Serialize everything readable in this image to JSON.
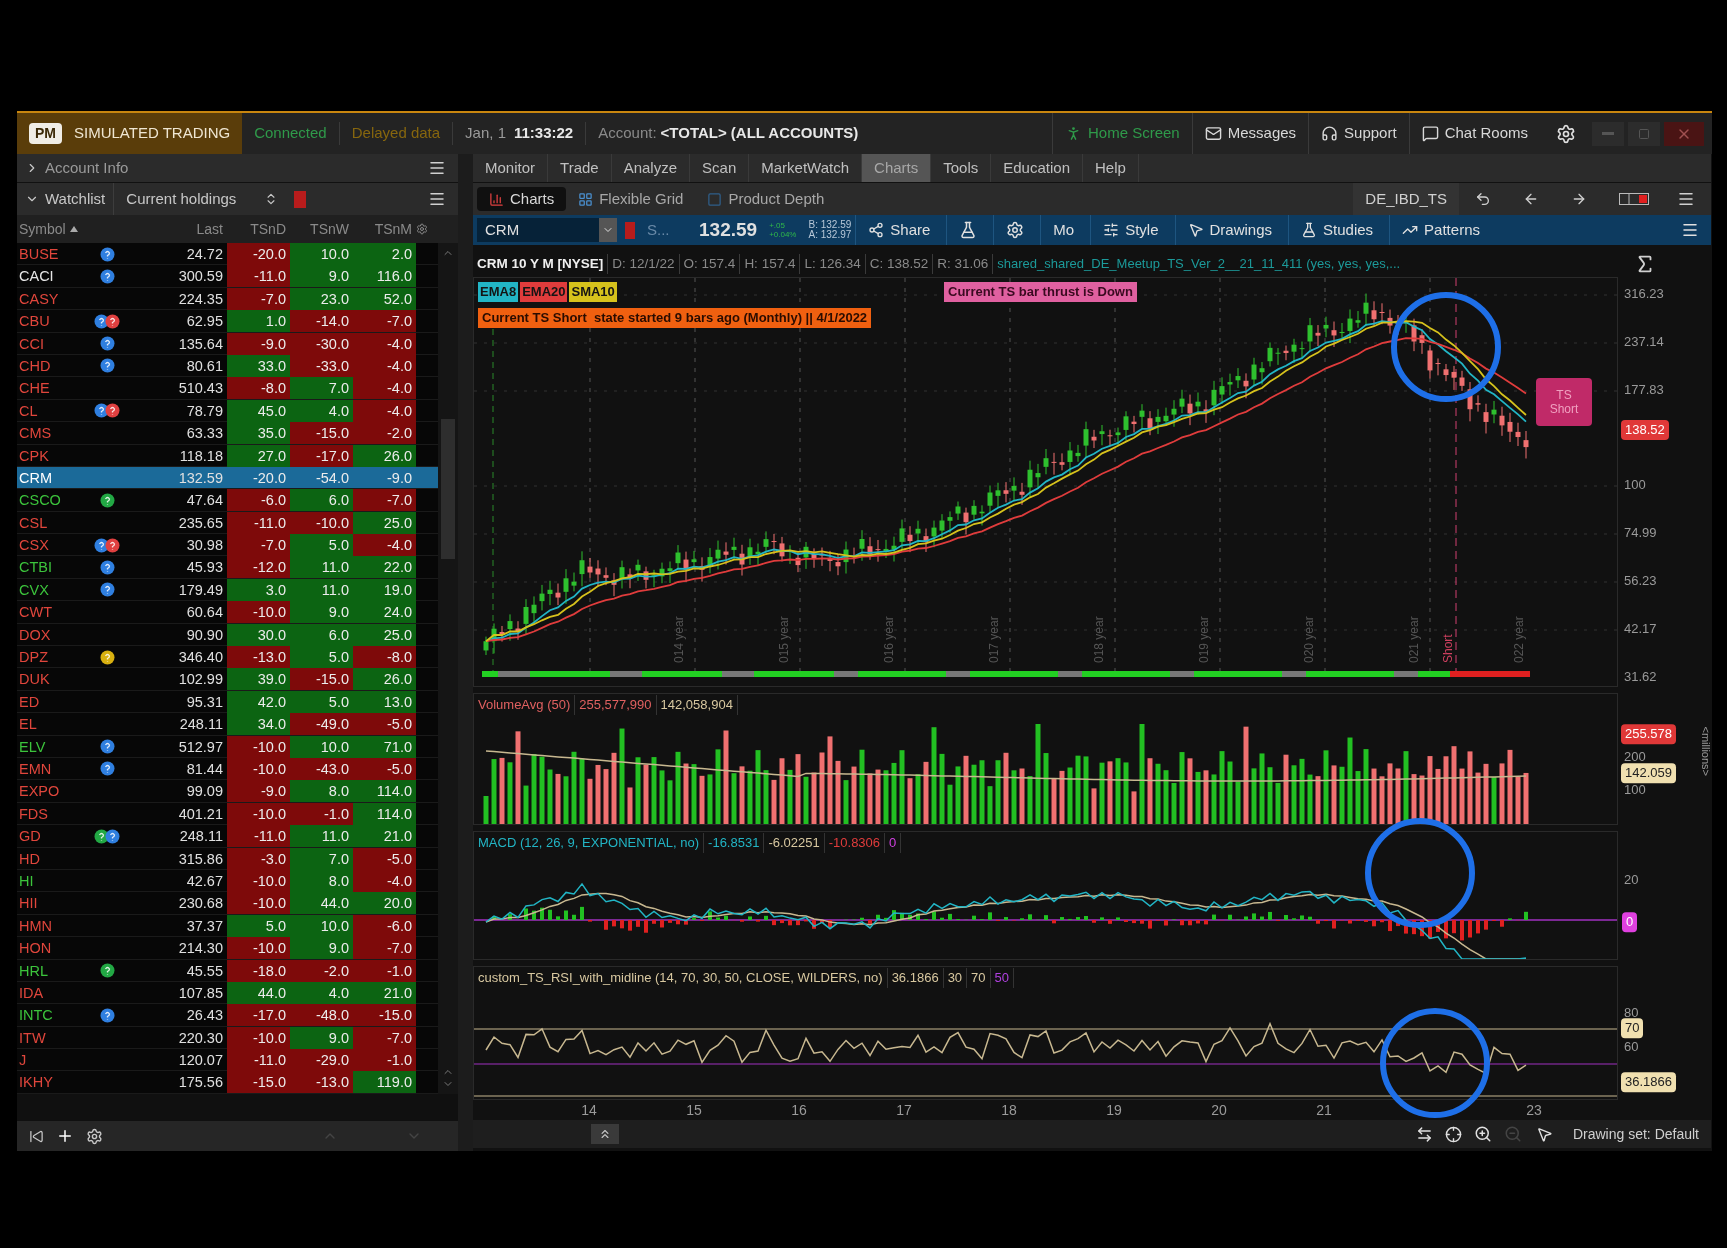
{
  "title_bar": {
    "badge": "PM",
    "mode": "SIMULATED TRADING",
    "connection": "Connected",
    "data_status": "Delayed data",
    "date": "Jan, 1",
    "time": "11:33:22",
    "account_label": "Account:",
    "account": "<TOTAL> (ALL ACCOUNTS)",
    "links": [
      {
        "kind": "home",
        "label": "Home Screen"
      },
      {
        "kind": "mail",
        "label": "Messages"
      },
      {
        "kind": "support",
        "label": "Support"
      },
      {
        "kind": "chat",
        "label": "Chat Rooms"
      }
    ]
  },
  "account_info": {
    "label": "Account Info",
    "expanded": false
  },
  "watchlist": {
    "label": "Watchlist",
    "expanded": true,
    "list": "Current holdings",
    "columns": [
      "Symbol",
      "Last",
      "TSnD",
      "TSnW",
      "TSnM"
    ],
    "rows": [
      {
        "symbol": "BUSE",
        "color": "#e0463c",
        "badges": [
          {
            "kind": "info"
          }
        ],
        "last": "24.72",
        "values": [
          "-20.0",
          "10.0",
          "2.0"
        ],
        "up": [
          false,
          true,
          true
        ],
        "selected": false
      },
      {
        "symbol": "CACI",
        "color": "#e6e6e6",
        "badges": [
          {
            "kind": "info"
          }
        ],
        "last": "300.59",
        "values": [
          "-11.0",
          "9.0",
          "116.0"
        ],
        "up": [
          false,
          true,
          true
        ],
        "selected": false
      },
      {
        "symbol": "CASY",
        "color": "#e0463c",
        "last": "224.35",
        "values": [
          "-7.0",
          "23.0",
          "52.0"
        ],
        "up": [
          false,
          true,
          true
        ],
        "selected": false
      },
      {
        "symbol": "CBU",
        "color": "#e0463c",
        "badges": [
          {
            "kind": "info"
          },
          {
            "kind": "alert"
          }
        ],
        "last": "62.95",
        "values": [
          "1.0",
          "-14.0",
          "-7.0"
        ],
        "up": [
          true,
          false,
          false
        ],
        "selected": false
      },
      {
        "symbol": "CCI",
        "color": "#e0463c",
        "badges": [
          {
            "kind": "info"
          }
        ],
        "last": "135.64",
        "values": [
          "-9.0",
          "-30.0",
          "-4.0"
        ],
        "up": [
          false,
          false,
          false
        ],
        "selected": false
      },
      {
        "symbol": "CHD",
        "color": "#e0463c",
        "badges": [
          {
            "kind": "info"
          }
        ],
        "last": "80.61",
        "values": [
          "33.0",
          "-33.0",
          "-4.0"
        ],
        "up": [
          true,
          false,
          false
        ],
        "selected": false
      },
      {
        "symbol": "CHE",
        "color": "#e0463c",
        "last": "510.43",
        "values": [
          "-8.0",
          "7.0",
          "-4.0"
        ],
        "up": [
          false,
          true,
          false
        ],
        "selected": false
      },
      {
        "symbol": "CL",
        "color": "#e0463c",
        "badges": [
          {
            "kind": "info"
          },
          {
            "kind": "alert"
          }
        ],
        "last": "78.79",
        "values": [
          "45.0",
          "4.0",
          "-4.0"
        ],
        "up": [
          true,
          true,
          false
        ],
        "selected": false
      },
      {
        "symbol": "CMS",
        "color": "#e0463c",
        "last": "63.33",
        "values": [
          "35.0",
          "-15.0",
          "-2.0"
        ],
        "up": [
          true,
          false,
          false
        ],
        "selected": false
      },
      {
        "symbol": "CPK",
        "color": "#e0463c",
        "last": "118.18",
        "values": [
          "27.0",
          "-17.0",
          "26.0"
        ],
        "up": [
          true,
          false,
          true
        ],
        "selected": false
      },
      {
        "symbol": "CRM",
        "last": "132.59",
        "values": [
          "-20.0",
          "-54.0",
          "-9.0"
        ],
        "selected": true
      },
      {
        "symbol": "CSCO",
        "color": "#3cc43c",
        "badges": [
          {
            "kind": "event"
          }
        ],
        "last": "47.64",
        "values": [
          "-6.0",
          "6.0",
          "-7.0"
        ],
        "up": [
          false,
          true,
          false
        ],
        "selected": false
      },
      {
        "symbol": "CSL",
        "color": "#e0463c",
        "last": "235.65",
        "values": [
          "-11.0",
          "-10.0",
          "25.0"
        ],
        "up": [
          false,
          false,
          true
        ],
        "selected": false
      },
      {
        "symbol": "CSX",
        "color": "#e0463c",
        "badges": [
          {
            "kind": "info"
          },
          {
            "kind": "alert"
          }
        ],
        "last": "30.98",
        "values": [
          "-7.0",
          "5.0",
          "-4.0"
        ],
        "up": [
          false,
          true,
          false
        ],
        "selected": false
      },
      {
        "symbol": "CTBI",
        "color": "#3cc43c",
        "badges": [
          {
            "kind": "info"
          }
        ],
        "last": "45.93",
        "values": [
          "-12.0",
          "11.0",
          "22.0"
        ],
        "up": [
          false,
          true,
          true
        ],
        "selected": false
      },
      {
        "symbol": "CVX",
        "color": "#3cc43c",
        "badges": [
          {
            "kind": "info"
          }
        ],
        "last": "179.49",
        "values": [
          "3.0",
          "11.0",
          "19.0"
        ],
        "up": [
          true,
          true,
          true
        ],
        "selected": false
      },
      {
        "symbol": "CWT",
        "color": "#e0463c",
        "last": "60.64",
        "values": [
          "-10.0",
          "9.0",
          "24.0"
        ],
        "up": [
          false,
          true,
          true
        ],
        "selected": false
      },
      {
        "symbol": "DOX",
        "color": "#e0463c",
        "last": "90.90",
        "values": [
          "30.0",
          "6.0",
          "25.0"
        ],
        "up": [
          true,
          true,
          true
        ],
        "selected": false
      },
      {
        "symbol": "DPZ",
        "color": "#e0463c",
        "badges": [
          {
            "kind": "dividend"
          }
        ],
        "last": "346.40",
        "values": [
          "-13.0",
          "5.0",
          "-8.0"
        ],
        "up": [
          false,
          true,
          false
        ],
        "selected": false
      },
      {
        "symbol": "DUK",
        "color": "#e0463c",
        "last": "102.99",
        "values": [
          "39.0",
          "-15.0",
          "26.0"
        ],
        "up": [
          true,
          false,
          true
        ],
        "selected": false
      },
      {
        "symbol": "ED",
        "color": "#e0463c",
        "last": "95.31",
        "values": [
          "42.0",
          "5.0",
          "13.0"
        ],
        "up": [
          true,
          true,
          true
        ],
        "selected": false
      },
      {
        "symbol": "EL",
        "color": "#e0463c",
        "last": "248.11",
        "values": [
          "34.0",
          "-49.0",
          "-5.0"
        ],
        "up": [
          true,
          false,
          false
        ],
        "selected": false
      },
      {
        "symbol": "ELV",
        "color": "#3cc43c",
        "badges": [
          {
            "kind": "info"
          }
        ],
        "last": "512.97",
        "values": [
          "-10.0",
          "10.0",
          "71.0"
        ],
        "up": [
          false,
          true,
          true
        ],
        "selected": false
      },
      {
        "symbol": "EMN",
        "color": "#e0463c",
        "badges": [
          {
            "kind": "info"
          }
        ],
        "last": "81.44",
        "values": [
          "-10.0",
          "-43.0",
          "-5.0"
        ],
        "up": [
          false,
          false,
          false
        ],
        "selected": false
      },
      {
        "symbol": "EXPO",
        "color": "#e0463c",
        "last": "99.09",
        "values": [
          "-9.0",
          "8.0",
          "114.0"
        ],
        "up": [
          false,
          true,
          true
        ],
        "selected": false
      },
      {
        "symbol": "FDS",
        "color": "#e0463c",
        "last": "401.21",
        "values": [
          "-10.0",
          "-1.0",
          "114.0"
        ],
        "up": [
          false,
          false,
          true
        ],
        "selected": false
      },
      {
        "symbol": "GD",
        "color": "#e0463c",
        "badges": [
          {
            "kind": "event"
          },
          {
            "kind": "info"
          }
        ],
        "last": "248.11",
        "values": [
          "-11.0",
          "11.0",
          "21.0"
        ],
        "up": [
          false,
          true,
          true
        ],
        "selected": false
      },
      {
        "symbol": "HD",
        "color": "#e0463c",
        "last": "315.86",
        "values": [
          "-3.0",
          "7.0",
          "-5.0"
        ],
        "up": [
          false,
          true,
          false
        ],
        "selected": false
      },
      {
        "symbol": "HI",
        "color": "#3cc43c",
        "last": "42.67",
        "values": [
          "-10.0",
          "8.0",
          "-4.0"
        ],
        "up": [
          false,
          true,
          false
        ],
        "selected": false
      },
      {
        "symbol": "HII",
        "color": "#e0463c",
        "last": "230.68",
        "values": [
          "-10.0",
          "44.0",
          "20.0"
        ],
        "up": [
          false,
          true,
          true
        ],
        "selected": false
      },
      {
        "symbol": "HMN",
        "color": "#e0463c",
        "last": "37.37",
        "values": [
          "5.0",
          "10.0",
          "-6.0"
        ],
        "up": [
          true,
          true,
          false
        ],
        "selected": false
      },
      {
        "symbol": "HON",
        "color": "#e0463c",
        "last": "214.30",
        "values": [
          "-10.0",
          "9.0",
          "-7.0"
        ],
        "up": [
          false,
          true,
          false
        ],
        "selected": false
      },
      {
        "symbol": "HRL",
        "color": "#3cc43c",
        "badges": [
          {
            "kind": "event"
          }
        ],
        "last": "45.55",
        "values": [
          "-18.0",
          "-2.0",
          "-1.0"
        ],
        "up": [
          false,
          false,
          false
        ],
        "selected": false
      },
      {
        "symbol": "IDA",
        "color": "#e0463c",
        "last": "107.85",
        "values": [
          "44.0",
          "4.0",
          "21.0"
        ],
        "up": [
          true,
          true,
          true
        ],
        "selected": false
      },
      {
        "symbol": "INTC",
        "color": "#3cc43c",
        "badges": [
          {
            "kind": "info"
          }
        ],
        "last": "26.43",
        "values": [
          "-17.0",
          "-48.0",
          "-15.0"
        ],
        "up": [
          false,
          false,
          false
        ],
        "selected": false
      },
      {
        "symbol": "ITW",
        "color": "#e0463c",
        "last": "220.30",
        "values": [
          "-10.0",
          "9.0",
          "-7.0"
        ],
        "up": [
          false,
          true,
          false
        ],
        "selected": false
      },
      {
        "symbol": "J",
        "color": "#e0463c",
        "last": "120.07",
        "values": [
          "-11.0",
          "-29.0",
          "-1.0"
        ],
        "up": [
          false,
          false,
          false
        ],
        "selected": false
      },
      {
        "symbol": "IKHY",
        "color": "#e0463c",
        "last": "175.56",
        "values": [
          "-15.0",
          "-13.0",
          "119.0"
        ],
        "up": [
          false,
          false,
          true
        ],
        "selected": false
      }
    ]
  },
  "main_tabs": [
    {
      "label": "Monitor",
      "selected": false
    },
    {
      "label": "Trade",
      "selected": false
    },
    {
      "label": "Analyze",
      "selected": false
    },
    {
      "label": "Scan",
      "selected": false
    },
    {
      "label": "MarketWatch",
      "selected": false
    },
    {
      "label": "Charts",
      "selected": true
    },
    {
      "label": "Tools",
      "selected": false
    },
    {
      "label": "Education",
      "selected": false
    },
    {
      "label": "Help",
      "selected": false
    }
  ],
  "sub_tabs": [
    {
      "label": "Charts",
      "selected": true
    },
    {
      "label": "Flexible Grid",
      "selected": false
    },
    {
      "label": "Product Depth",
      "selected": false
    }
  ],
  "layout_name": "DE_IBD_TS",
  "chart_toolbar": {
    "symbol": "CRM",
    "symbol_hint": "S...",
    "price": "132.59",
    "change": "+.05",
    "change_pct": "+0.04%",
    "bid": "B: 132.59",
    "ask": "A: 132.97",
    "buttons": [
      {
        "kind": "share",
        "label": "Share"
      },
      {
        "kind": "flask"
      },
      {
        "kind": "gear"
      },
      {
        "kind": "text",
        "label": "Mo"
      },
      {
        "kind": "style",
        "label": "Style"
      },
      {
        "kind": "drawings",
        "label": "Drawings"
      },
      {
        "kind": "studies",
        "label": "Studies"
      },
      {
        "kind": "patterns",
        "label": "Patterns"
      }
    ]
  },
  "chart": {
    "header": [
      "CRM 10 Y M [NYSE]",
      "D: 12/1/22",
      "O: 157.4",
      "H: 157.4",
      "L: 126.34",
      "C: 138.52",
      "R: 31.06"
    ],
    "study_set": "shared_shared_DE_Meetup_TS_Ver_2__21_11_411 (yes, yes, yes,...",
    "legend": [
      {
        "label": "EMA8",
        "color": "#22b5c5"
      },
      {
        "label": "EMA20",
        "color": "#e03c3c"
      },
      {
        "label": "SMA10",
        "color": "#d6c21c"
      }
    ],
    "thrust": "Current TS bar thrust is Down",
    "state": "Current TS Short  state started 9 bars ago (Monthly) || 4/1/2022",
    "price_ticks": [
      "316.23",
      "237.14",
      "177.83",
      "100",
      "74.99",
      "56.23",
      "42.17",
      "31.62"
    ],
    "last_price": "138.52",
    "bubble": [
      "TS",
      "Short"
    ],
    "year_labels": [
      "014 year",
      "015 year",
      "016 year",
      "017 year",
      "018 year",
      "019 year",
      "020 year",
      "021 year",
      "022 year"
    ],
    "signal_label": "Short"
  },
  "volume": {
    "title": "VolumeAvg (50)",
    "values": [
      "255,577,990",
      "142,058,904"
    ],
    "ticks": [
      "200",
      "100"
    ],
    "markers": [
      "255.578",
      "142.059"
    ],
    "unit": "<millions>"
  },
  "macd": {
    "title": "MACD (12, 26, 9, EXPONENTIAL, no)",
    "values": [
      "-16.8531",
      "-6.02251",
      "-10.8306",
      "0"
    ],
    "ticks": [
      "20"
    ],
    "zero": "0"
  },
  "rsi": {
    "title": "custom_TS_RSI_with_midline (14, 70, 30, 50, CLOSE, WILDERS, no)",
    "values": [
      "36.1866",
      "30",
      "70",
      "50"
    ],
    "ticks": [
      "80",
      "60"
    ],
    "markers": [
      "70",
      "36.1866"
    ]
  },
  "time_axis": [
    "14",
    "15",
    "16",
    "17",
    "18",
    "19",
    "20",
    "21",
    "23"
  ],
  "status": "Drawing set: Default"
}
